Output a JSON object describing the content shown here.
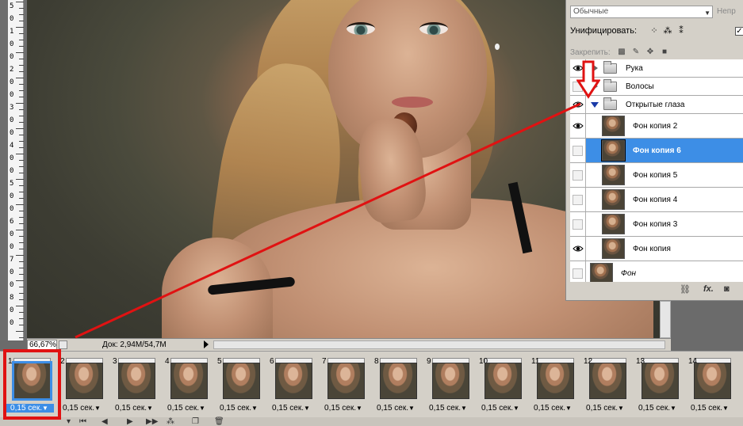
{
  "layers_panel": {
    "blend_mode": "Обычные",
    "opacity_label": "Непр",
    "unify_label": "Унифицировать:",
    "unify_checked": true,
    "lock_label": "Закрепить:",
    "layers": [
      {
        "name": "Рука",
        "type": "group",
        "visible": true,
        "expanded": false
      },
      {
        "name": "Волосы",
        "type": "group",
        "visible": false,
        "expanded": false
      },
      {
        "name": "Открытые глаза",
        "type": "group",
        "visible": true,
        "expanded": true
      },
      {
        "name": "Фон копия 2",
        "type": "layer",
        "visible": true,
        "selected": false
      },
      {
        "name": "Фон копия 6",
        "type": "layer",
        "visible": false,
        "selected": true
      },
      {
        "name": "Фон копия 5",
        "type": "layer",
        "visible": false,
        "selected": false
      },
      {
        "name": "Фон копия 4",
        "type": "layer",
        "visible": false,
        "selected": false
      },
      {
        "name": "Фон копия 3",
        "type": "layer",
        "visible": false,
        "selected": false
      },
      {
        "name": "Фон копия",
        "type": "layer",
        "visible": true,
        "selected": false
      },
      {
        "name": "Фон",
        "type": "background",
        "visible": false,
        "selected": false
      }
    ],
    "footer_icons": [
      "link-icon",
      "fx-icon",
      "mask-icon"
    ],
    "fx_label": "fx."
  },
  "status_bar": {
    "zoom": "66,67%",
    "doc_info": "Док: 2,94M/54,7M"
  },
  "ruler_labels": [
    "5",
    "0",
    "1",
    "0",
    "0",
    "2",
    "0",
    "0",
    "3",
    "0",
    "0",
    "4",
    "0",
    "0",
    "5",
    "0",
    "0",
    "6",
    "0",
    "0",
    "7",
    "0",
    "0",
    "8",
    "0",
    "0"
  ],
  "timeline": {
    "frames": [
      {
        "number": "1",
        "delay": "0,15 сек."
      },
      {
        "number": "2",
        "delay": "0,15 сек."
      },
      {
        "number": "3",
        "delay": "0,15 сек."
      },
      {
        "number": "4",
        "delay": "0,15 сек."
      },
      {
        "number": "5",
        "delay": "0,15 сек."
      },
      {
        "number": "6",
        "delay": "0,15 сек."
      },
      {
        "number": "7",
        "delay": "0,15 сек."
      },
      {
        "number": "8",
        "delay": "0,15 сек."
      },
      {
        "number": "9",
        "delay": "0,15 сек."
      },
      {
        "number": "10",
        "delay": "0,15 сек."
      },
      {
        "number": "11",
        "delay": "0,15 сек."
      },
      {
        "number": "12",
        "delay": "0,15 сек."
      },
      {
        "number": "13",
        "delay": "0,15 сек."
      },
      {
        "number": "14",
        "delay": "0,15 сек."
      }
    ],
    "selected_frame": "1",
    "dropdown_glyph": "▼"
  },
  "colors": {
    "selection": "#3d8ee6",
    "annotation": "#e01212",
    "panel_bg": "#d4d0c8"
  }
}
